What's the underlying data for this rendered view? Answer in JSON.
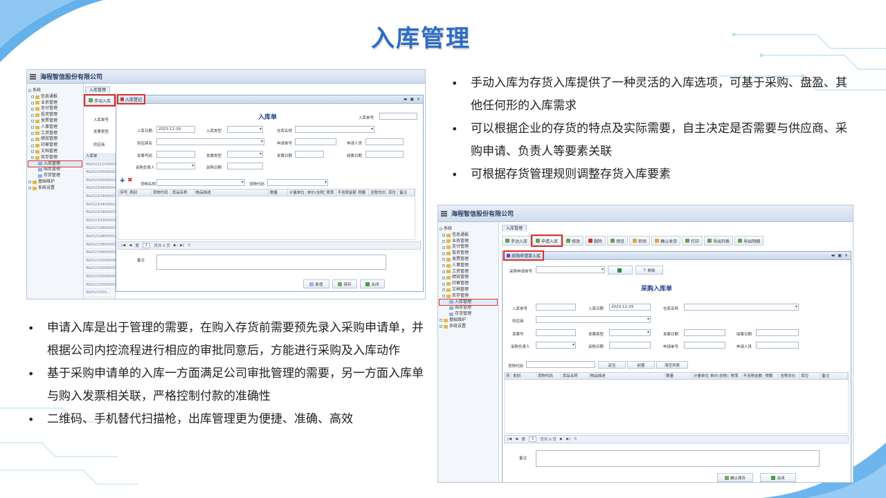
{
  "slide": {
    "title": "入库管理",
    "bullets_top": [
      "手动入库为存货入库提供了一种灵活的入库选项，可基于采购、盘盈、其他任何形的入库需求",
      "可以根据企业的存货的特点及实际需要，自主决定是否需要与供应商、采购申请、负责人等要素关联",
      "可根据存货管理规则调整存货入库要素"
    ],
    "bullets_bottom": [
      "申请入库是出于管理的需要，在购入存货前需要预先录入采购申请单，并根据公司内控流程进行相应的审批同意后，方能进行采购及入库动作",
      "基于采购申请单的入库一方面满足公司审批管理的需要，另一方面入库单与购入发票相关联，严格控制付款的准确性",
      "二维码、手机替代扫描枪，出库管理更为便捷、准确、高效"
    ],
    "colors": {
      "title": "#2b6cc4",
      "highlight": "#e0312c",
      "deco": "#4aa3e8"
    }
  },
  "shot1": {
    "company": "海程智信股份有限公司",
    "tree": {
      "root": "系统",
      "items": [
        "信息通报",
        "业务管理",
        "支付管理",
        "投资管理",
        "发票管理",
        "人事管理",
        "工资管理",
        "绩效管理",
        "印章管理",
        "文档管理",
        "库存管理"
      ],
      "sub_items": [
        "入库管理",
        "出库管理",
        "存货管理"
      ],
      "tail": [
        "基础维护",
        "系统设置"
      ]
    },
    "tab": "入库管理",
    "toolbar_manual": "手动入库",
    "filter_labels": [
      "入库单号",
      "发票类型",
      "供应商"
    ],
    "list_header": "入库单",
    "list_rows": [
      "IN20221100001",
      "IN20220500002",
      "IN20220500001",
      "IN20220400004",
      "IN20220400003",
      "IN20220400002",
      "IN20220400001",
      "IN20220300001",
      "IN20210800003",
      "IN20210800002",
      "IN20210800001",
      "IN20210600001",
      "IN20210500006",
      "IN20210500005",
      "IN20210500004",
      "IN20210500003",
      "IN2021050..."
    ],
    "dialog_title": "入库登记",
    "dialog_ctrl": "▬ ▣ ✕",
    "form_title": "入库单",
    "fields": {
      "receipt_no": "入库单号",
      "date": "入库日期",
      "date_value": "2023-12-29",
      "type": "入库类型",
      "warehouse": "仓库名称",
      "supplier": "供应商名",
      "apply_no": "申请单号",
      "applicant": "申请人员",
      "invoice_no": "发票号码",
      "invoice_type": "发票类型",
      "invoice_date": "发票日期",
      "receive_date": "收票日期",
      "buyer": "采购负责人",
      "purchase_date": "采购日期",
      "goods_name": "货物名称",
      "goods_code": "货物代码"
    },
    "grid_cols": [
      "序号",
      "类别",
      "货物代码",
      "货品名称",
      "物品描述",
      "数量",
      "计量单位",
      "单价(含税)",
      "税率",
      "不含税金额",
      "税额",
      "含税总价",
      "库位",
      "备注"
    ],
    "pager": [
      "|◀",
      "◀",
      "第",
      "1",
      "页共 0 页",
      "▶",
      "▶|",
      "↻"
    ],
    "remark": "备注",
    "buttons": {
      "new": "新增",
      "save": "保存",
      "close": "关闭"
    }
  },
  "shot2": {
    "company": "海程智信股份有限公司",
    "tree": {
      "root": "系统",
      "items": [
        "信息通报",
        "业务管理",
        "支付管理",
        "投资管理",
        "发票管理",
        "人事管理",
        "工资管理",
        "绩效管理",
        "印章管理",
        "文档管理",
        "库存管理"
      ],
      "sub_items": [
        "入库管理",
        "出库管理",
        "存货管理"
      ],
      "tail": [
        "基础维护",
        "系统设置"
      ]
    },
    "tab": "入库管理",
    "toolbar": [
      "手动入库",
      "申请入库",
      "修改",
      "删除",
      "预览",
      "检验",
      "确认收货",
      "打印",
      "导出列表",
      "导出明细"
    ],
    "dialog_title": "采购申请单入库",
    "dialog_ctrl": "▬ ▣ ✕",
    "apply_label": "采购申请单号",
    "refresh": "刷新",
    "form_title": "采购入库单",
    "fields": {
      "receipt_no": "入库单号",
      "date": "入库日期",
      "date_value": "2023-12-29",
      "warehouse": "仓库名称",
      "supplier": "供应商",
      "invoice_no": "发票号",
      "invoice_type": "发票类型",
      "invoice_date": "发票日期",
      "receive_date": "收票日期",
      "buyer": "采购负责人",
      "purchase_date": "采购日期",
      "apply_no": "申请单号",
      "applicant": "申请人员",
      "goods_code": "货物代码"
    },
    "grid_buttons": [
      "定位",
      "前置",
      "清空列表"
    ],
    "grid_cols": [
      "序",
      "类别",
      "货物代码",
      "货品名称",
      "物品描述",
      "数量",
      "计量单位",
      "单价(含税)",
      "税率",
      "不含税金额",
      "税额",
      "含税总价",
      "库位",
      "备注"
    ],
    "pager": [
      "|◀",
      "◀",
      "第",
      "1",
      "页共 0 页",
      "▶",
      "▶|",
      "↻"
    ],
    "remark": "备注",
    "buttons": {
      "confirm": "确认保存",
      "close": "关闭"
    }
  }
}
